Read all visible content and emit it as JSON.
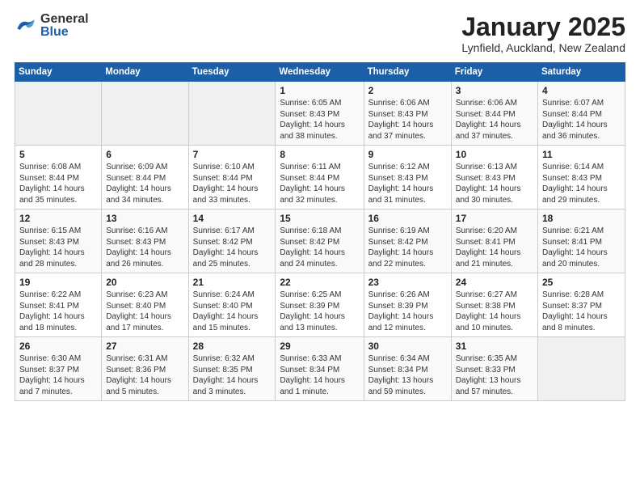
{
  "header": {
    "logo_general": "General",
    "logo_blue": "Blue",
    "title": "January 2025",
    "subtitle": "Lynfield, Auckland, New Zealand"
  },
  "weekdays": [
    "Sunday",
    "Monday",
    "Tuesday",
    "Wednesday",
    "Thursday",
    "Friday",
    "Saturday"
  ],
  "weeks": [
    [
      {
        "day": "",
        "info": ""
      },
      {
        "day": "",
        "info": ""
      },
      {
        "day": "",
        "info": ""
      },
      {
        "day": "1",
        "info": "Sunrise: 6:05 AM\nSunset: 8:43 PM\nDaylight: 14 hours\nand 38 minutes."
      },
      {
        "day": "2",
        "info": "Sunrise: 6:06 AM\nSunset: 8:43 PM\nDaylight: 14 hours\nand 37 minutes."
      },
      {
        "day": "3",
        "info": "Sunrise: 6:06 AM\nSunset: 8:44 PM\nDaylight: 14 hours\nand 37 minutes."
      },
      {
        "day": "4",
        "info": "Sunrise: 6:07 AM\nSunset: 8:44 PM\nDaylight: 14 hours\nand 36 minutes."
      }
    ],
    [
      {
        "day": "5",
        "info": "Sunrise: 6:08 AM\nSunset: 8:44 PM\nDaylight: 14 hours\nand 35 minutes."
      },
      {
        "day": "6",
        "info": "Sunrise: 6:09 AM\nSunset: 8:44 PM\nDaylight: 14 hours\nand 34 minutes."
      },
      {
        "day": "7",
        "info": "Sunrise: 6:10 AM\nSunset: 8:44 PM\nDaylight: 14 hours\nand 33 minutes."
      },
      {
        "day": "8",
        "info": "Sunrise: 6:11 AM\nSunset: 8:44 PM\nDaylight: 14 hours\nand 32 minutes."
      },
      {
        "day": "9",
        "info": "Sunrise: 6:12 AM\nSunset: 8:43 PM\nDaylight: 14 hours\nand 31 minutes."
      },
      {
        "day": "10",
        "info": "Sunrise: 6:13 AM\nSunset: 8:43 PM\nDaylight: 14 hours\nand 30 minutes."
      },
      {
        "day": "11",
        "info": "Sunrise: 6:14 AM\nSunset: 8:43 PM\nDaylight: 14 hours\nand 29 minutes."
      }
    ],
    [
      {
        "day": "12",
        "info": "Sunrise: 6:15 AM\nSunset: 8:43 PM\nDaylight: 14 hours\nand 28 minutes."
      },
      {
        "day": "13",
        "info": "Sunrise: 6:16 AM\nSunset: 8:43 PM\nDaylight: 14 hours\nand 26 minutes."
      },
      {
        "day": "14",
        "info": "Sunrise: 6:17 AM\nSunset: 8:42 PM\nDaylight: 14 hours\nand 25 minutes."
      },
      {
        "day": "15",
        "info": "Sunrise: 6:18 AM\nSunset: 8:42 PM\nDaylight: 14 hours\nand 24 minutes."
      },
      {
        "day": "16",
        "info": "Sunrise: 6:19 AM\nSunset: 8:42 PM\nDaylight: 14 hours\nand 22 minutes."
      },
      {
        "day": "17",
        "info": "Sunrise: 6:20 AM\nSunset: 8:41 PM\nDaylight: 14 hours\nand 21 minutes."
      },
      {
        "day": "18",
        "info": "Sunrise: 6:21 AM\nSunset: 8:41 PM\nDaylight: 14 hours\nand 20 minutes."
      }
    ],
    [
      {
        "day": "19",
        "info": "Sunrise: 6:22 AM\nSunset: 8:41 PM\nDaylight: 14 hours\nand 18 minutes."
      },
      {
        "day": "20",
        "info": "Sunrise: 6:23 AM\nSunset: 8:40 PM\nDaylight: 14 hours\nand 17 minutes."
      },
      {
        "day": "21",
        "info": "Sunrise: 6:24 AM\nSunset: 8:40 PM\nDaylight: 14 hours\nand 15 minutes."
      },
      {
        "day": "22",
        "info": "Sunrise: 6:25 AM\nSunset: 8:39 PM\nDaylight: 14 hours\nand 13 minutes."
      },
      {
        "day": "23",
        "info": "Sunrise: 6:26 AM\nSunset: 8:39 PM\nDaylight: 14 hours\nand 12 minutes."
      },
      {
        "day": "24",
        "info": "Sunrise: 6:27 AM\nSunset: 8:38 PM\nDaylight: 14 hours\nand 10 minutes."
      },
      {
        "day": "25",
        "info": "Sunrise: 6:28 AM\nSunset: 8:37 PM\nDaylight: 14 hours\nand 8 minutes."
      }
    ],
    [
      {
        "day": "26",
        "info": "Sunrise: 6:30 AM\nSunset: 8:37 PM\nDaylight: 14 hours\nand 7 minutes."
      },
      {
        "day": "27",
        "info": "Sunrise: 6:31 AM\nSunset: 8:36 PM\nDaylight: 14 hours\nand 5 minutes."
      },
      {
        "day": "28",
        "info": "Sunrise: 6:32 AM\nSunset: 8:35 PM\nDaylight: 14 hours\nand 3 minutes."
      },
      {
        "day": "29",
        "info": "Sunrise: 6:33 AM\nSunset: 8:34 PM\nDaylight: 14 hours\nand 1 minute."
      },
      {
        "day": "30",
        "info": "Sunrise: 6:34 AM\nSunset: 8:34 PM\nDaylight: 13 hours\nand 59 minutes."
      },
      {
        "day": "31",
        "info": "Sunrise: 6:35 AM\nSunset: 8:33 PM\nDaylight: 13 hours\nand 57 minutes."
      },
      {
        "day": "",
        "info": ""
      }
    ]
  ]
}
